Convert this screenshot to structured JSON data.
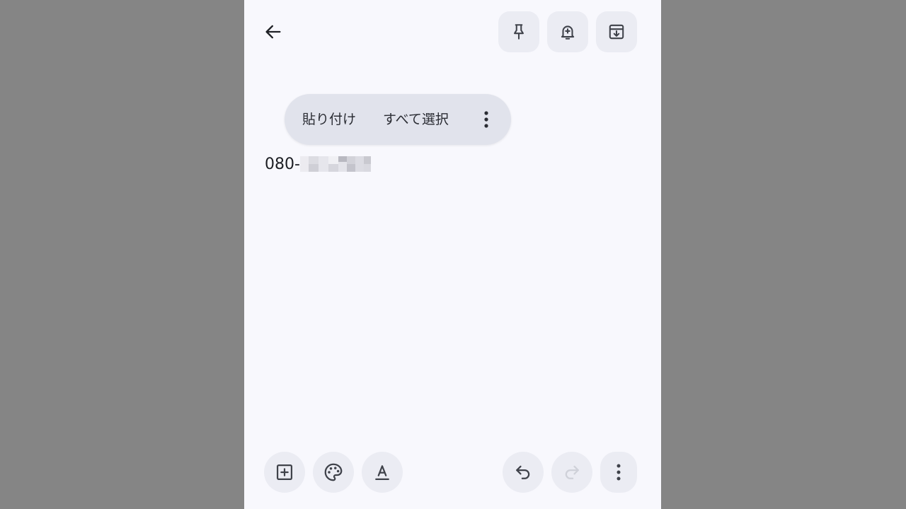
{
  "header": {
    "back_icon": "arrow-left-icon",
    "pin_icon": "pin-icon",
    "reminder_icon": "bell-plus-icon",
    "archive_icon": "archive-icon"
  },
  "context_menu": {
    "paste_label": "貼り付け",
    "select_all_label": "すべて選択",
    "more_icon": "more-vertical-icon"
  },
  "note": {
    "text_prefix": "080-"
  },
  "bottom_bar": {
    "add_icon": "add-box-icon",
    "palette_icon": "palette-icon",
    "text_format_icon": "text-format-icon",
    "undo_icon": "undo-icon",
    "redo_icon": "redo-icon",
    "more_icon": "more-vertical-icon"
  },
  "colors": {
    "background": "#f8f8fd",
    "outside": "#858585",
    "button_fill": "#ebecf3",
    "menu_fill": "#e1e3ec",
    "icon": "#3f424a"
  }
}
